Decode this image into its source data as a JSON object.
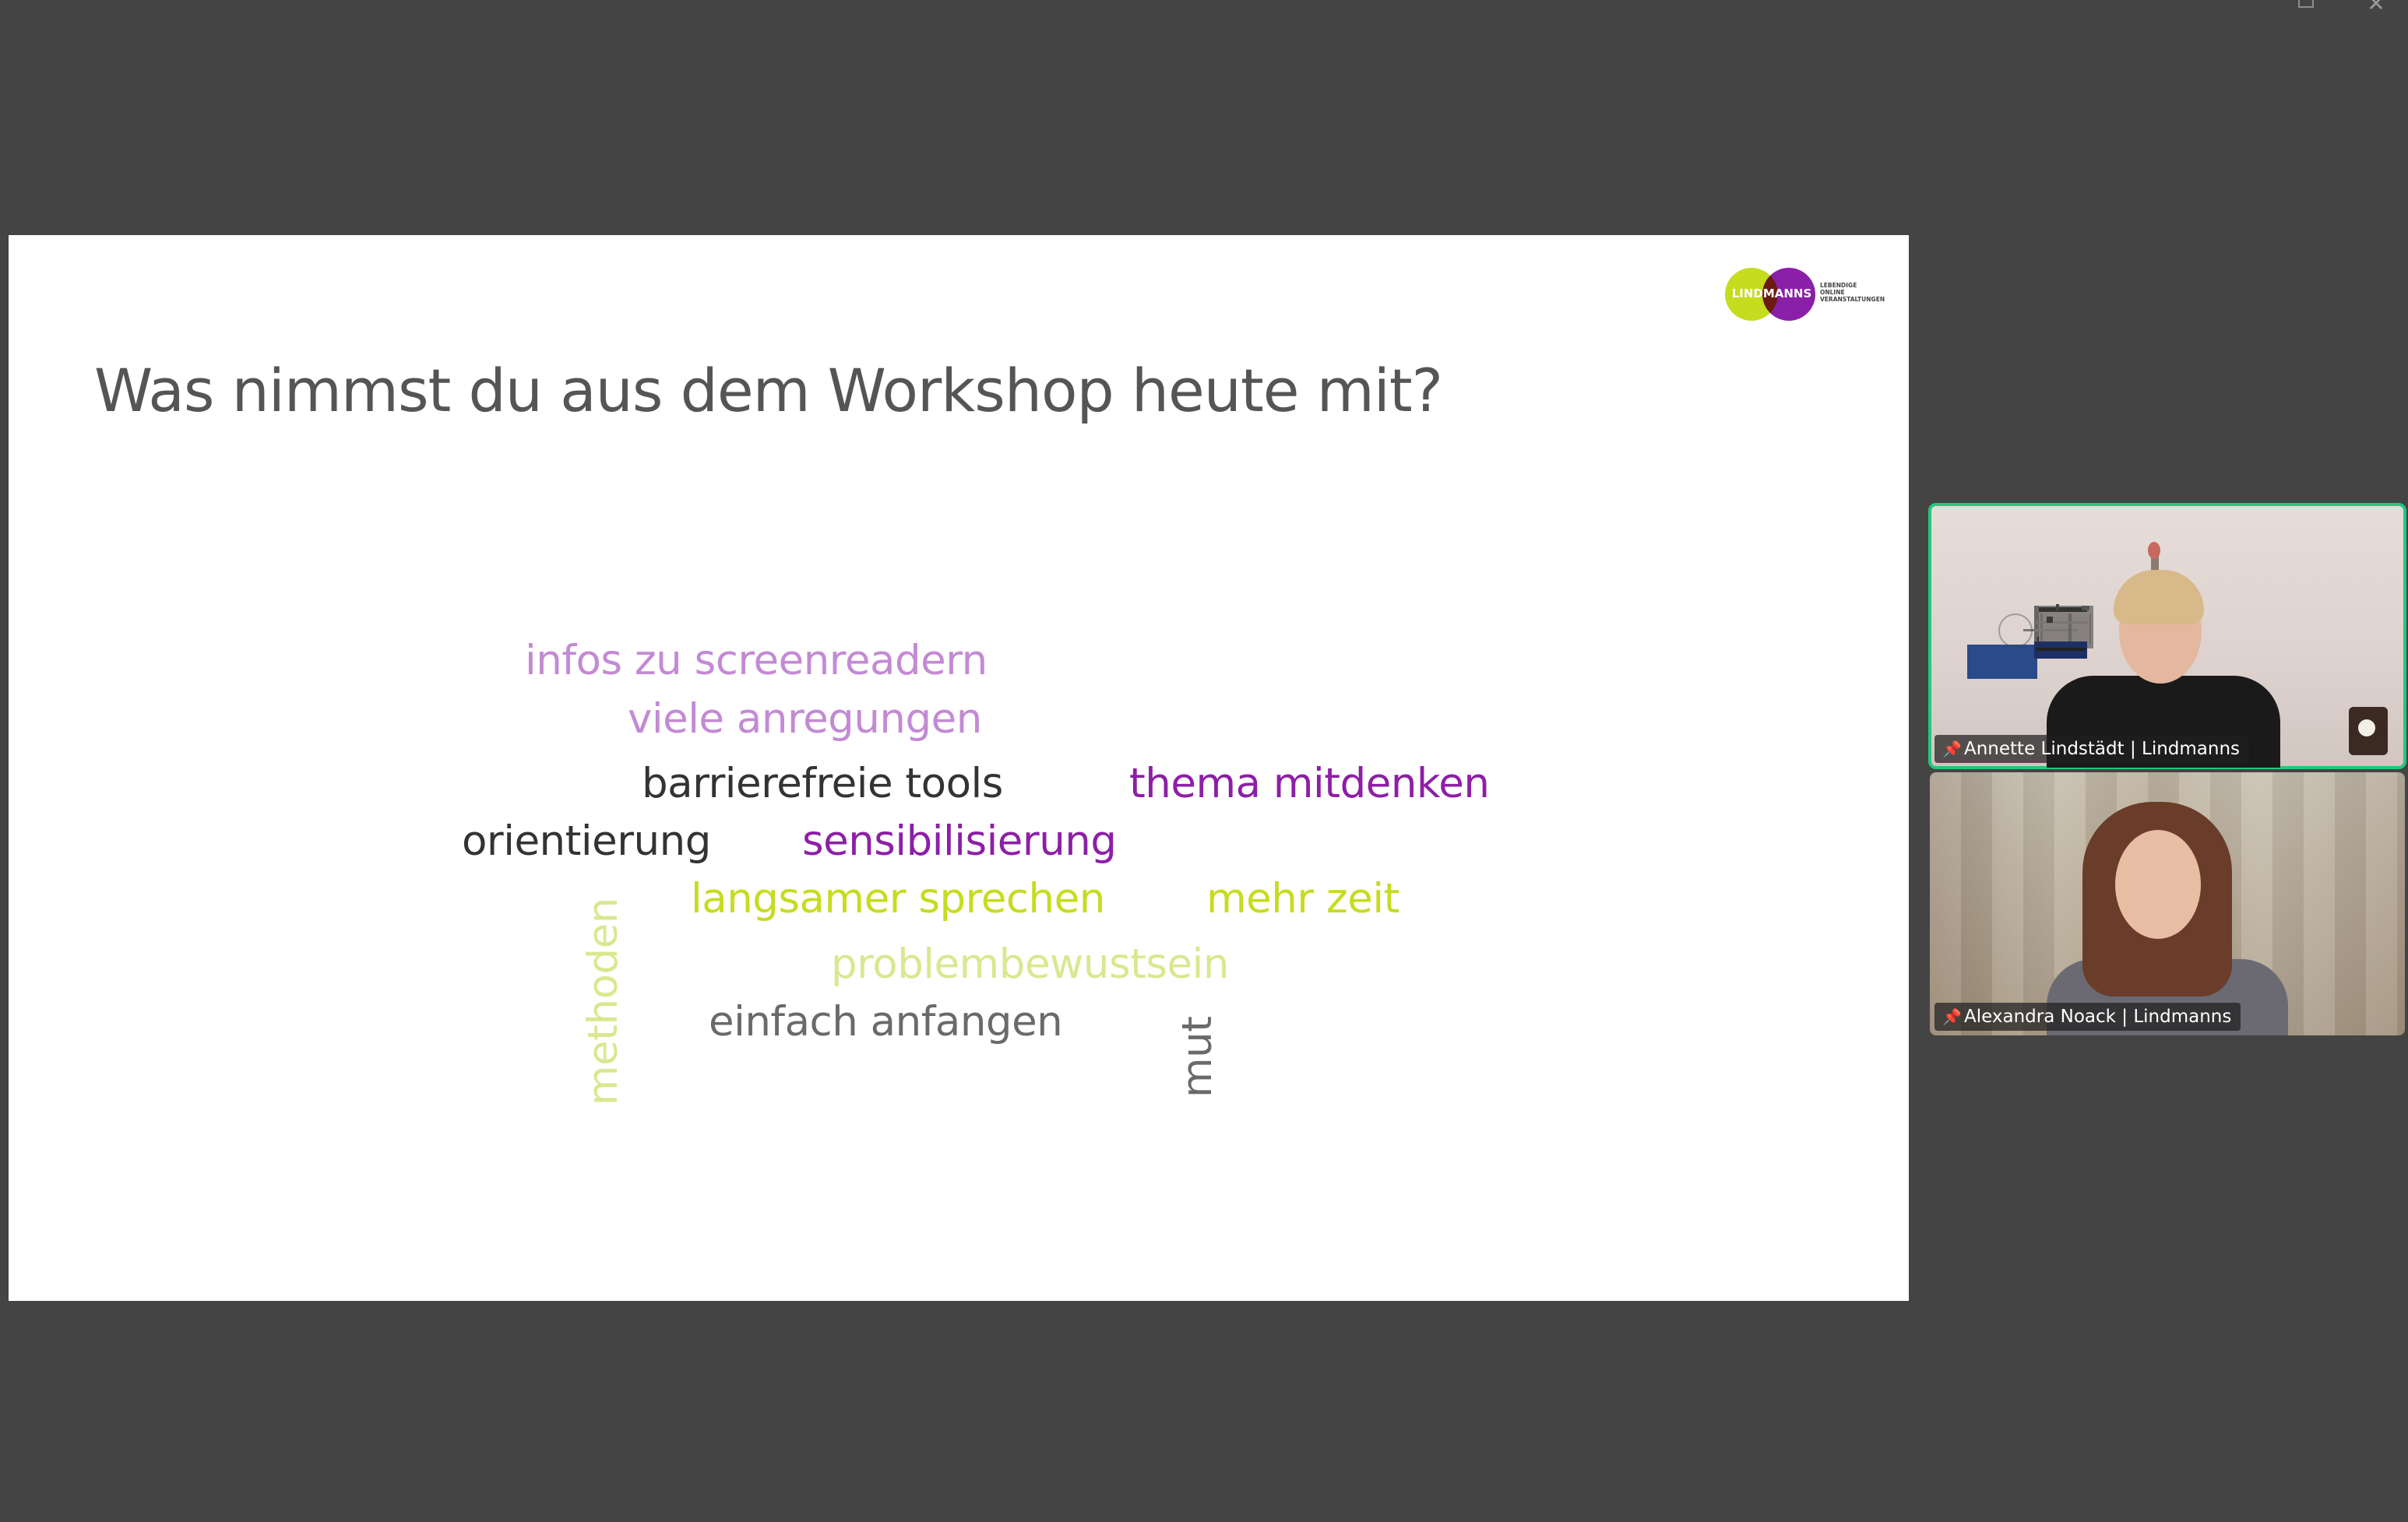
{
  "window": {
    "restore_label": "",
    "close_label": "✕"
  },
  "slide": {
    "title": "Was nimmst du aus dem Workshop heute mit?",
    "logo": {
      "brand": "LINDMANNS",
      "tagline": "LEBENDIGE ONLINE VERANSTALTUNGEN"
    },
    "words": [
      "infos zu screenreadern",
      "viele anregungen",
      "barrierefreie tools",
      "thema mitdenken",
      "orientierung",
      "sensibilisierung",
      "langsamer sprechen",
      "mehr zeit",
      "problembewustsein",
      "einfach anfangen",
      "methoden",
      "mut"
    ],
    "colors": {
      "lilac": "#c38ad4",
      "dark": "#333333",
      "purple": "#8d1fa6",
      "lime": "#c6dc1e",
      "pale_lime": "#d9e88f",
      "grey": "#6a6a6a"
    }
  },
  "participants": [
    {
      "name": "Annette Lindstädt | Lindmanns",
      "speaking": true,
      "icon": "pin-icon"
    },
    {
      "name": "Alexandra Noack | Lindmanns",
      "speaking": false,
      "icon": "pin-icon"
    }
  ],
  "accent_color": "#24c77e"
}
